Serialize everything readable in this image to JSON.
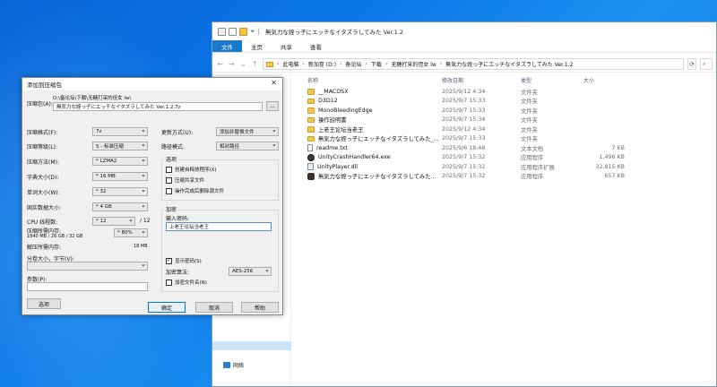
{
  "explorer": {
    "title": "無気力な姪っ子にエッチなイタズラしてみた Ver.1.2",
    "ribbon_tabs": [
      "文件",
      "主页",
      "共享",
      "查看"
    ],
    "breadcrumb": [
      "此电脑",
      "新加卷 (D:)",
      "备论坛",
      "下载",
      "无糖打采的侄女 lw",
      "無気力な姪っ子にエッチなイタズラしてみた Ver.1.2"
    ],
    "nav_network": "网络",
    "columns": {
      "name": "名称",
      "date": "修改日期",
      "type": "类型",
      "size": "大小"
    },
    "files": [
      {
        "name": "__MACOSX",
        "date": "2025/9/12 4:34",
        "type": "文件夹",
        "size": "",
        "icon": "folder-icon"
      },
      {
        "name": "D3D12",
        "date": "2025/9/7 15:33",
        "type": "文件夹",
        "size": "",
        "icon": "folder-icon"
      },
      {
        "name": "MonoBleedingEdge",
        "date": "2025/9/7 15:33",
        "type": "文件夹",
        "size": "",
        "icon": "folder-icon"
      },
      {
        "name": "操作説明書",
        "date": "2025/9/7 15:34",
        "type": "文件夹",
        "size": "",
        "icon": "folder-icon"
      },
      {
        "name": "上老王论坛当老王",
        "date": "2025/9/12 4:34",
        "type": "文件夹",
        "size": "",
        "icon": "folder-icon"
      },
      {
        "name": "無気力な姪っ子にエッチなイタズラしてみた_...",
        "date": "2025/9/7 15:33",
        "type": "文件夹",
        "size": "",
        "icon": "folder-icon"
      },
      {
        "name": "readme.txt",
        "date": "2025/9/6 18:48",
        "type": "文本文档",
        "size": "7 KB",
        "icon": "text-file-icon"
      },
      {
        "name": "UnityCrashHandler64.exe",
        "date": "2025/9/7 15:32",
        "type": "应用程序",
        "size": "1,496 KB",
        "icon": "exe-icon"
      },
      {
        "name": "UnityPlayer.dll",
        "date": "2025/9/7 15:32",
        "type": "应用程序扩展",
        "size": "32,815 KB",
        "icon": "dll-icon"
      },
      {
        "name": "無気力な姪っ子にエッチなイタズラしてみた...",
        "date": "2025/9/7 15:32",
        "type": "应用程序",
        "size": "657 KB",
        "icon": "game-exe-icon"
      }
    ]
  },
  "dialog": {
    "title": "添加到压缩包",
    "archive_label": "压缩包(A):",
    "archive_path": "D:\\备论坛\\下载\\无糖打采的侄女 lw\\",
    "archive_name": "無気力な姪っ子にエッチなイタズラしてみた Ver.1.2.7z",
    "browse_label": "...",
    "format_label": "压缩格式(F):",
    "format_value": "7z",
    "level_label": "压缩等级(L):",
    "level_value": "5 - 标准压缩",
    "method_label": "压缩方法(M):",
    "method_value": "* LZMA2",
    "dict_label": "字典大小(D):",
    "dict_value": "* 16 MB",
    "word_label": "单词大小(W):",
    "word_value": "* 32",
    "solid_label": "固实数据大小:",
    "solid_value": "* 4 GB",
    "cpu_label": "CPU 线程数:",
    "cpu_value": "* 12",
    "cpu_total": "/ 12",
    "mem_label": "压缩所需内存:",
    "mem_value": "1840 MB / 26 GB / 32 GB",
    "mem_percent": "* 80%",
    "decomp_label": "解压所需内存:",
    "decomp_value": "18 MB",
    "split_label": "分卷大小，字节(V):",
    "params_label": "参数(P):",
    "options_button": "选项",
    "update_label": "更新方式(U):",
    "update_value": "添加并替换文件",
    "pathmode_label": "路径模式:",
    "pathmode_value": "相对路径",
    "options_group": "选项",
    "opt_sfx": "创建自释放程序(X)",
    "opt_shared": "压缩共享文件",
    "opt_delete": "操作完成后删除源文件",
    "encrypt_group": "加密",
    "password_label": "输入密码:",
    "password_value": "上老王论坛当老王",
    "show_password": "显示密码(S)",
    "enc_method_label": "加密算法:",
    "enc_method_value": "AES-256",
    "encrypt_names": "加密文件名(N)",
    "ok_button": "确定",
    "cancel_button": "取消",
    "help_button": "帮助"
  }
}
